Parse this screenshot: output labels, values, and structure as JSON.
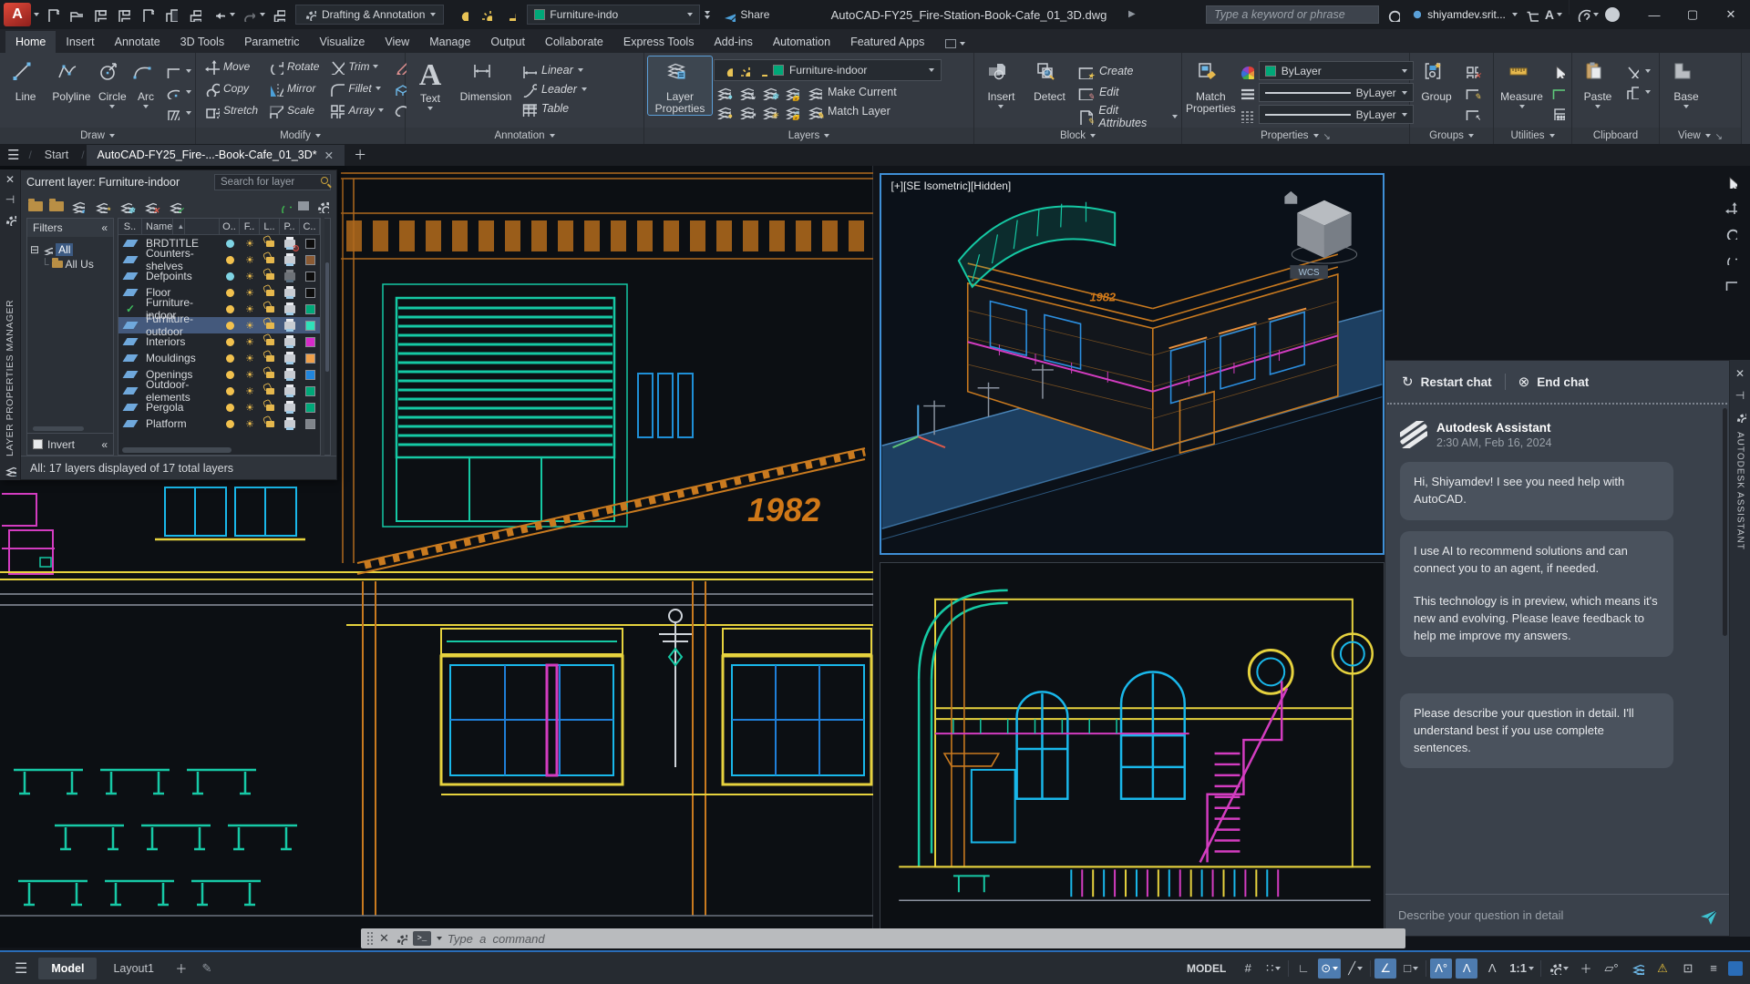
{
  "colors": {
    "accent_blue": "#4a90d9",
    "current_layer_green": "#00a878",
    "selected_layer_teal": "#2fe2ba",
    "viewport_border": "#3f8fd6"
  },
  "titlebar": {
    "workspace": "Drafting & Annotation",
    "layer_pill": "Furniture-indo",
    "share_label": "Share",
    "filename": "AutoCAD-FY25_Fire-Station-Book-Cafe_01_3D.dwg",
    "search_placeholder": "Type a keyword or phrase",
    "username": "shiyamdev.srit..."
  },
  "ribbon_tabs": [
    "Home",
    "Insert",
    "Annotate",
    "3D Tools",
    "Parametric",
    "Visualize",
    "View",
    "Manage",
    "Output",
    "Collaborate",
    "Express Tools",
    "Add-ins",
    "Automation",
    "Featured Apps"
  ],
  "ribbon": {
    "draw": {
      "title": "Draw",
      "line": "Line",
      "polyline": "Polyline",
      "circle": "Circle",
      "arc": "Arc"
    },
    "modify": {
      "title": "Modify",
      "move": "Move",
      "rotate": "Rotate",
      "trim": "Trim",
      "copy": "Copy",
      "mirror": "Mirror",
      "fillet": "Fillet",
      "stretch": "Stretch",
      "scale": "Scale",
      "array": "Array"
    },
    "annotation": {
      "title": "Annotation",
      "text": "Text",
      "dimension": "Dimension",
      "linear": "Linear",
      "leader": "Leader",
      "table": "Table"
    },
    "layers": {
      "title": "Layers",
      "layer_properties": "Layer Properties",
      "current_layer": "Furniture-indoor",
      "make_current": "Make Current",
      "match_layer": "Match Layer"
    },
    "block": {
      "title": "Block",
      "insert": "Insert",
      "detect": "Detect",
      "create": "Create",
      "edit": "Edit",
      "edit_attributes": "Edit Attributes"
    },
    "properties": {
      "title": "Properties",
      "match_properties": "Match Properties",
      "bylayer1": "ByLayer",
      "bylayer2": "ByLayer",
      "bylayer3": "ByLayer"
    },
    "groups": {
      "title": "Groups",
      "group": "Group"
    },
    "utilities": {
      "title": "Utilities",
      "measure": "Measure"
    },
    "clipboard": {
      "title": "Clipboard",
      "paste": "Paste"
    },
    "view": {
      "title": "View",
      "base": "Base"
    }
  },
  "file_tabs": {
    "start": "Start",
    "doc": "AutoCAD-FY25_Fire-...-Book-Cafe_01_3D*"
  },
  "layer_palette": {
    "vertical_title": "LAYER PROPERTIES MANAGER",
    "current_layer_label": "Current layer: Furniture-indoor",
    "search_placeholder": "Search for layer",
    "filters_label": "Filters",
    "tree": [
      "All",
      "All Us"
    ],
    "columns": [
      "S..",
      "Name",
      "O..",
      "F..",
      "L..",
      "P..",
      "C.."
    ],
    "layers": [
      {
        "name": "BRDTITLE",
        "color": "#0d0d0d",
        "bulb": "off",
        "status": "layer",
        "plot": "no"
      },
      {
        "name": "Counters-shelves",
        "color": "#8a5a33",
        "bulb": "on",
        "status": "layer",
        "plot": "yes"
      },
      {
        "name": "Defpoints",
        "color": "#0d0d0d",
        "bulb": "off",
        "status": "layer",
        "plot": "gray"
      },
      {
        "name": "Floor",
        "color": "#0d0d0d",
        "bulb": "on",
        "status": "layer",
        "plot": "yes"
      },
      {
        "name": "Furniture-indoor",
        "color": "#00a878",
        "bulb": "on",
        "status": "current",
        "plot": "yes"
      },
      {
        "name": "Furniture-outdoor",
        "color": "#2fe2ba",
        "bulb": "on",
        "status": "layer",
        "plot": "yes",
        "selected": true
      },
      {
        "name": "Interiors",
        "color": "#d62bc9",
        "bulb": "on",
        "status": "layer",
        "plot": "yes"
      },
      {
        "name": "Mouldings",
        "color": "#f0a04a",
        "bulb": "on",
        "status": "layer",
        "plot": "yes"
      },
      {
        "name": "Openings",
        "color": "#2186dd",
        "bulb": "on",
        "status": "layer",
        "plot": "yes"
      },
      {
        "name": "Outdoor-elements",
        "color": "#00a878",
        "bulb": "on",
        "status": "layer",
        "plot": "yes"
      },
      {
        "name": "Pergola",
        "color": "#00a878",
        "bulb": "on",
        "status": "layer",
        "plot": "yes"
      },
      {
        "name": "Platform",
        "color": "#80858b",
        "bulb": "on",
        "status": "layer",
        "plot": "yes"
      }
    ],
    "invert_label": "Invert",
    "status_text": "All: 17 layers displayed of 17 total layers"
  },
  "viewports": {
    "iso_label": "[+][SE Isometric][Hidden]",
    "wcs_label": "WCS",
    "year_text": "1982"
  },
  "chat": {
    "restart": "Restart chat",
    "end": "End chat",
    "assistant_name": "Autodesk Assistant",
    "timestamp": "2:30 AM, Feb 16, 2024",
    "messages": [
      "Hi, Shiyamdev! I see you need help with AutoCAD.",
      "I use AI to recommend solutions and can connect you to an agent, if needed.",
      "This technology is in preview, which means it's new and evolving. Please leave feedback to help me improve my answers.",
      "Please describe your question in detail. I'll understand best if you use complete sentences."
    ],
    "input_placeholder": "Describe your question in detail",
    "vertical_title": "AUTODESK ASSISTANT"
  },
  "command_line": {
    "placeholder": "Type  a  command"
  },
  "status_bar": {
    "model_tab": "Model",
    "layout_tab": "Layout1",
    "model_badge": "MODEL",
    "scale": "1:1"
  }
}
